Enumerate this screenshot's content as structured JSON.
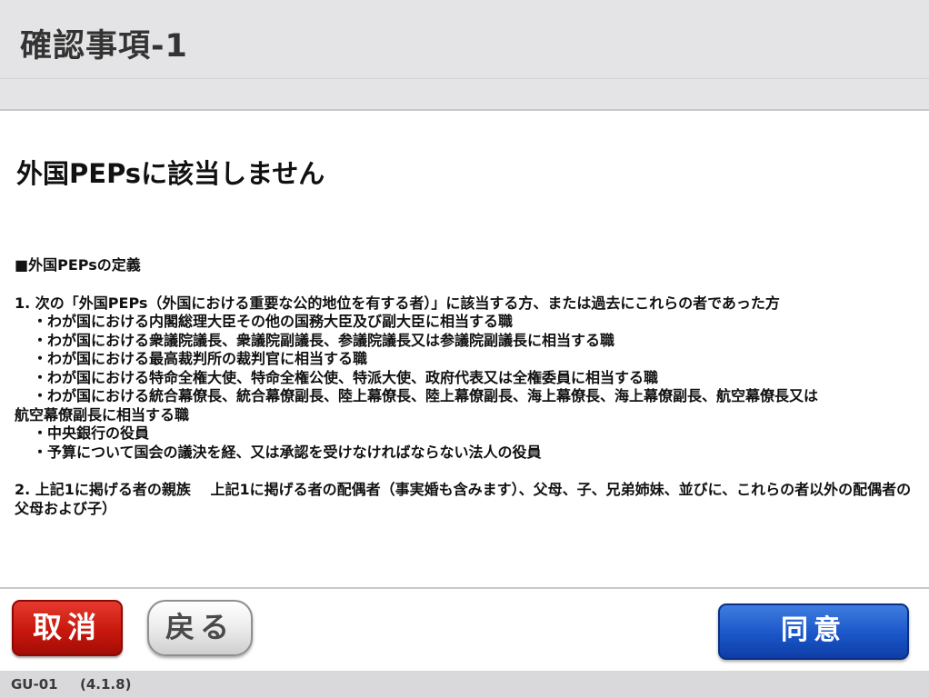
{
  "header": {
    "title": "確認事項-1"
  },
  "main": {
    "heading": "外国PEPsに該当しません",
    "definition_title": "■外国PEPsの定義",
    "item1": {
      "intro": "1. 次の「外国PEPs（外国における重要な公的地位を有する者）」に該当する方、または過去にこれらの者であった方",
      "bullets": [
        "・わが国における内閣総理大臣その他の国務大臣及び副大臣に相当する職",
        "・わが国における衆議院議長、衆議院副議長、参議院議長又は参議院副議長に相当する職",
        "・わが国における最高裁判所の裁判官に相当する職",
        "・わが国における特命全権大使、特命全権公使、特派大使、政府代表又は全権委員に相当する職",
        "・わが国における統合幕僚長、統合幕僚副長、陸上幕僚長、陸上幕僚副長、海上幕僚長、海上幕僚副長、航空幕僚長又は",
        "・中央銀行の役員",
        "・予算について国会の議決を経、又は承認を受けなければならない法人の役員"
      ],
      "bullet4_continuation": "航空幕僚副長に相当する職"
    },
    "item2": {
      "text": "2. 上記1に掲げる者の親族　 上記1に掲げる者の配偶者（事実婚も含みます）、父母、子、兄弟姉妹、並びに、これらの者以外の配偶者の父母および子）"
    }
  },
  "footer": {
    "cancel_label": "取消",
    "back_label": "戻る",
    "agree_label": "同意"
  },
  "status": {
    "screen_code": "GU-01",
    "version": "(4.1.8)"
  },
  "colors": {
    "cancel": "#c8180e",
    "agree": "#1a56c8",
    "header_bg": "#e4e4e6"
  }
}
